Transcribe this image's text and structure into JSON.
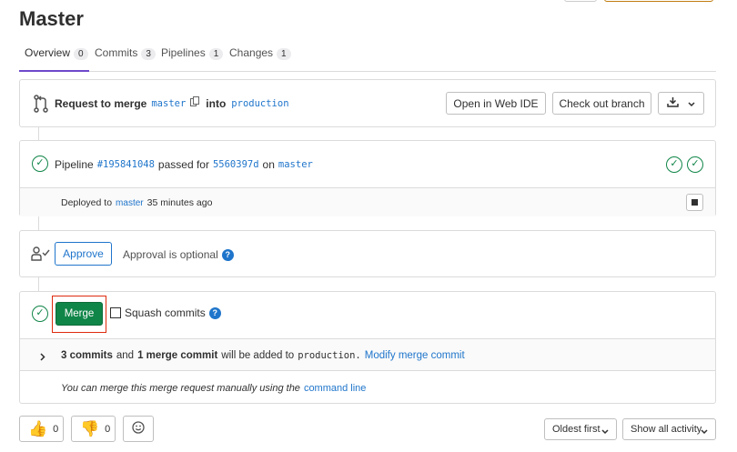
{
  "title": "Master",
  "tabs": [
    {
      "label": "Overview",
      "count": "0"
    },
    {
      "label": "Commits",
      "count": "3"
    },
    {
      "label": "Pipelines",
      "count": "1"
    },
    {
      "label": "Changes",
      "count": "1"
    }
  ],
  "request": {
    "prefix": "Request to merge",
    "source": "master",
    "into": "into",
    "target": "production",
    "open_ide": "Open in Web IDE",
    "checkout": "Check out branch"
  },
  "pipeline": {
    "label": "Pipeline",
    "id": "#195841048",
    "passed_for": "passed for",
    "commit": "5560397d",
    "on": "on",
    "branch": "master",
    "deployed_to": "Deployed to",
    "deployed_branch": "master",
    "deployed_time": "35 minutes ago"
  },
  "approval": {
    "approve_label": "Approve",
    "optional_text": "Approval is optional"
  },
  "merge": {
    "merge_label": "Merge",
    "squash_label": "Squash commits",
    "commits_bold": "3 commits",
    "and": "and",
    "merge_commit_bold": "1 merge commit",
    "will_be_added": "will be added to",
    "target": "production.",
    "modify": "Modify merge commit",
    "manual_text": "You can merge this merge request manually using the",
    "command_line": "command line"
  },
  "reactions": {
    "thumbs_up_count": "0",
    "thumbs_down_count": "0"
  },
  "footer": {
    "sort": "Oldest first",
    "filter": "Show all activity"
  }
}
